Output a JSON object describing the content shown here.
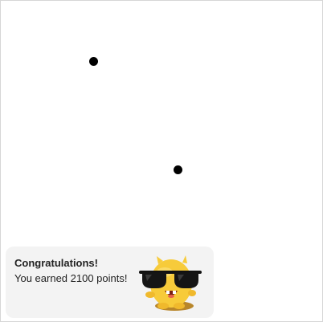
{
  "toast": {
    "title": "Congratulations!",
    "message": "You earned 2100 points!",
    "mascot_icon": "cool-yellow-monster-with-sunglasses-icon"
  },
  "colors": {
    "toast_background": "#f3f3f3",
    "dot": "#000000",
    "mascot_body": "#f7cb3a"
  }
}
